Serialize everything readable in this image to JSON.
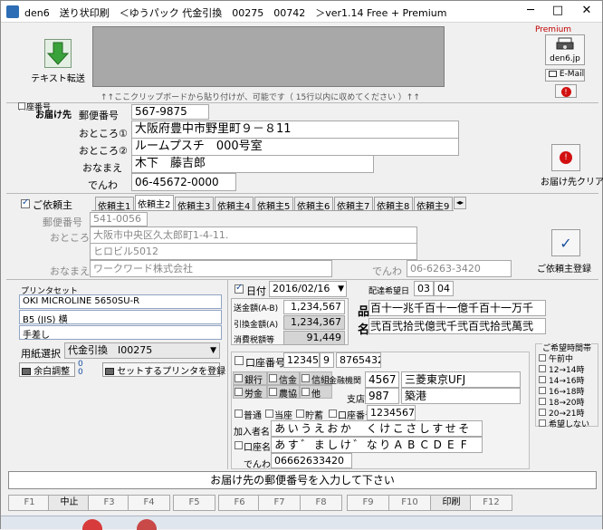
{
  "window": {
    "title": "den6　送り状印刷　＜ゆうパック 代金引換　00275　00742　＞ver1.14 Free + Premium"
  },
  "left_toolbar": {
    "text_transfer_label": "テキスト転送"
  },
  "paste_hint": "↑↑ここクリップボードから貼り付けが、可能です（ 15行以内に収めてください ）↑↑",
  "premium": {
    "label": "Premium",
    "den6_label": "den6.jp",
    "email_label": "E-Mail"
  },
  "recipient": {
    "section_label": "お届け先",
    "account_label": "口座番号",
    "postal_label": "郵便番号",
    "postal": "567-9875",
    "addr1_label": "おところ①",
    "addr1": "大阪府豊中市野里町９－８11",
    "addr2_label": "おところ②",
    "addr2": "ルームプスチ　000号室",
    "name_label": "おなまえ",
    "name": "木下　藤吉郎",
    "phone_label": "でんわ",
    "phone": "06-45672-0000",
    "clear_label": "お届け先クリア"
  },
  "sender": {
    "section_label": "ご依頼主",
    "tabs": [
      "依頼主1",
      "依頼主2",
      "依頼主3",
      "依頼主4",
      "依頼主5",
      "依頼主6",
      "依頼主7",
      "依頼主8",
      "依頼主9"
    ],
    "postal_label": "郵便番号",
    "postal": "541-0056",
    "addr_label": "おところ",
    "addr1": "大阪市中央区久太郎町1-4-11.",
    "addr2": "ヒロビル5012",
    "name_label": "おなまえ",
    "name": "ワークワード株式会社",
    "phone_label": "でんわ",
    "phone": "06-6263-3420",
    "register_label": "ご依頼主登録"
  },
  "printer": {
    "section_label": "プリンタセット",
    "name": "OKI MICROLINE 5650SU-R",
    "paper": "B5 (JIS) 横",
    "feed": "手差し",
    "paper_select_label": "用紙選択",
    "paper_select_value": "代金引換　Ⅰ00275",
    "margin_label": "余白調整",
    "margin_values": [
      "0",
      "0"
    ],
    "register_label": "セットするプリンタを登録"
  },
  "payment": {
    "date_label": "日付",
    "date": "2016/02/16",
    "delivery_label": "配達希望日",
    "delivery_month": "03",
    "delivery_day": "04",
    "send_amount_label": "送金額(A-B)",
    "send_amount": "1,234,567",
    "collect_amount_label": "引換金額(A)",
    "collect_amount": "1,234,367",
    "tax_label": "消費税額等",
    "tax": "91,449",
    "item_label": "品",
    "item_text": "百十一兆千百十一億千百十一万千",
    "name_label": "名",
    "name_text": "弐百弐拾弐億弐千弐百弐拾弐萬弐"
  },
  "bank": {
    "account_label": "口座番号",
    "account1": "12345",
    "account2": "9",
    "account3": "8765432x",
    "types": [
      "銀行",
      "信金",
      "信組",
      "労金",
      "農協",
      "他"
    ],
    "inst_label": "金融機関",
    "inst_code": "4567",
    "inst_name": "三菱東京UFJ",
    "branch_label": "支店",
    "branch_code": "987",
    "branch_name": "築港",
    "deposit_types": [
      "普通",
      "当座",
      "貯蓄"
    ],
    "deposit_account_label": "口座番号",
    "deposit_account": "1234567",
    "member_label": "加入者名",
    "member_name": [
      "あ",
      "い",
      "う",
      "え",
      "お",
      "か",
      "",
      "く",
      "け",
      "こ",
      "さ",
      "し",
      "す",
      "せ",
      "そ"
    ],
    "holder_label": "口座名義",
    "holder_name": [
      "あ",
      "す",
      "゛",
      "ま",
      "し",
      "け",
      "゛",
      "な",
      "り",
      "A",
      "B",
      "C",
      "D",
      "E",
      "F"
    ],
    "phone_label": "でんわ",
    "phone": "06662633420"
  },
  "time_pref": {
    "title": "ご希望時間帯",
    "items": [
      "午前中",
      "12→14時",
      "14→16時",
      "16→18時",
      "18→20時",
      "20→21時",
      "希望しない"
    ]
  },
  "status_message": "お届け先の郵便番号を入力して下さい",
  "fkeys": [
    {
      "label": "F1",
      "dark": false
    },
    {
      "label": "中止",
      "dark": true
    },
    {
      "label": "F3",
      "dark": false
    },
    {
      "label": "F4",
      "dark": false
    },
    {
      "label": "F5",
      "dark": false
    },
    {
      "label": "F6",
      "dark": false
    },
    {
      "label": "F7",
      "dark": false
    },
    {
      "label": "F8",
      "dark": false
    },
    {
      "label": "F9",
      "dark": false
    },
    {
      "label": "F10",
      "dark": false
    },
    {
      "label": "印刷",
      "dark": true
    },
    {
      "label": "F12",
      "dark": false
    }
  ]
}
